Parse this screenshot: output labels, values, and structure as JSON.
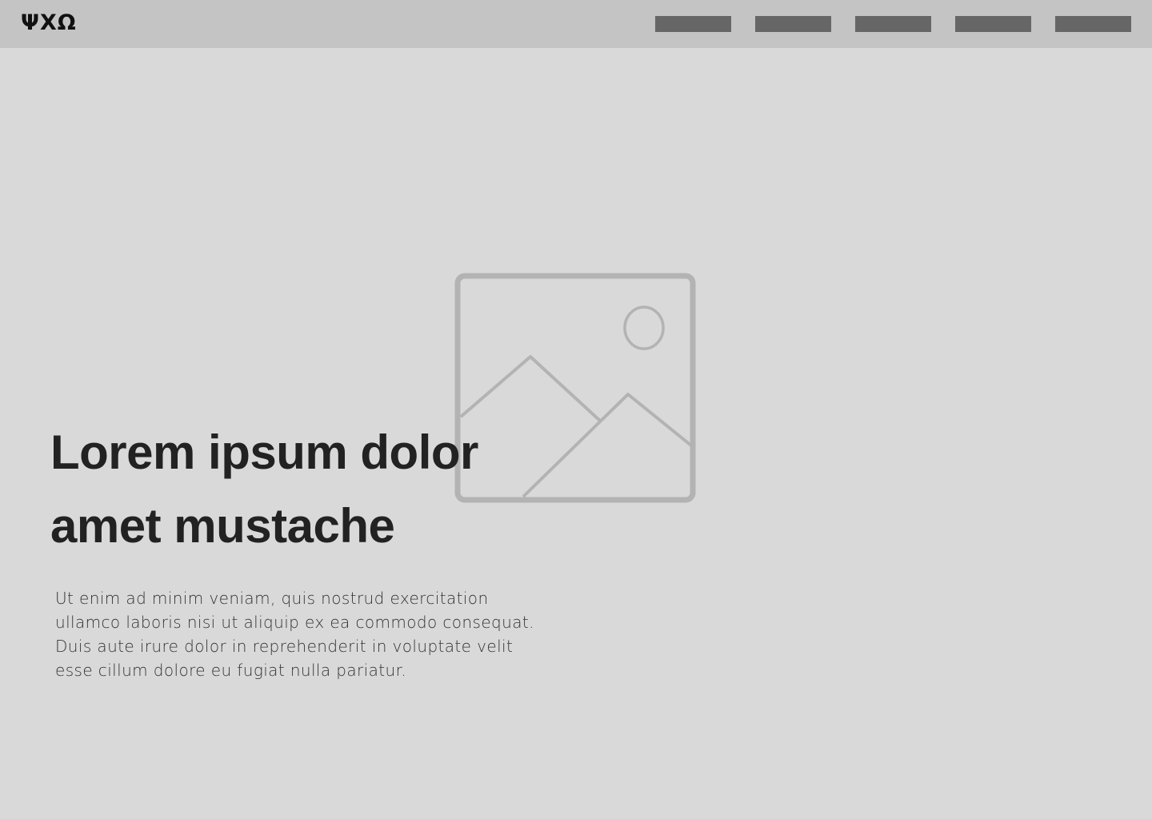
{
  "header": {
    "logo": "ΨΧΩ",
    "nav_items": [
      "",
      "",
      "",
      "",
      ""
    ]
  },
  "hero": {
    "image_icon": "image-placeholder-icon",
    "headline_lines": [
      "Lorem ipsum dolor",
      "amet mustache"
    ],
    "body_lines": [
      "Ut enim ad minim veniam, quis nostrud exercitation",
      "ullamco laboris nisi ut aliquip ex ea commodo consequat.",
      "Duis aute irure dolor in reprehenderit in voluptate velit",
      "esse cillum dolore eu fugiat nulla pariatur."
    ]
  },
  "colors": {
    "page_background": "#d9d9d9",
    "header_background": "#c4c4c4",
    "nav_placeholder": "#666666",
    "image_placeholder_stroke": "#b3b3b3",
    "headline_text": "#222222"
  }
}
